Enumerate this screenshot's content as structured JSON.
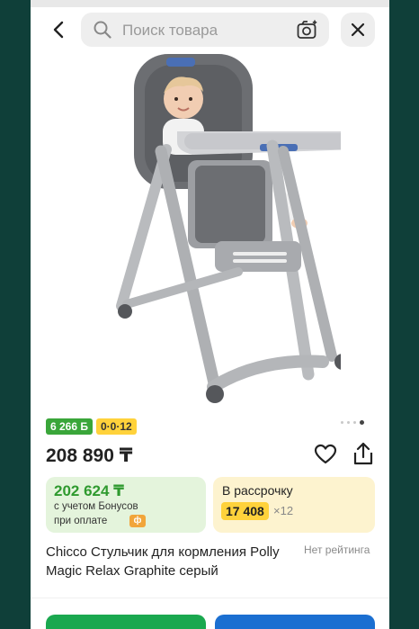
{
  "header": {
    "search_placeholder": "Поиск товара",
    "back_icon": "chevron-left-icon",
    "camera_icon": "camera-search-icon",
    "close_icon": "close-icon"
  },
  "gallery": {
    "page_count": 4,
    "active_index": 3
  },
  "badges": {
    "bonus": "6 266 Б",
    "installment": "0·0·12"
  },
  "price": "208 890 ₸",
  "bonus_box": {
    "amount": "202 624 ₸",
    "line1": "с учетом Бонусов",
    "line2": "при оплате",
    "coin_icon": "bonus-coin-icon"
  },
  "installment_box": {
    "label": "В рассрочку",
    "monthly": "17 408",
    "months": "×12"
  },
  "product": {
    "title": "Chicco Стульчик для кормления Polly Magic Relax Graphite серый",
    "rating": "Нет рейтинга"
  },
  "colors": {
    "green": "#1aa84f",
    "blue": "#1b6fd1",
    "yellow": "#ffd23b",
    "bg": "#0f3f39"
  }
}
